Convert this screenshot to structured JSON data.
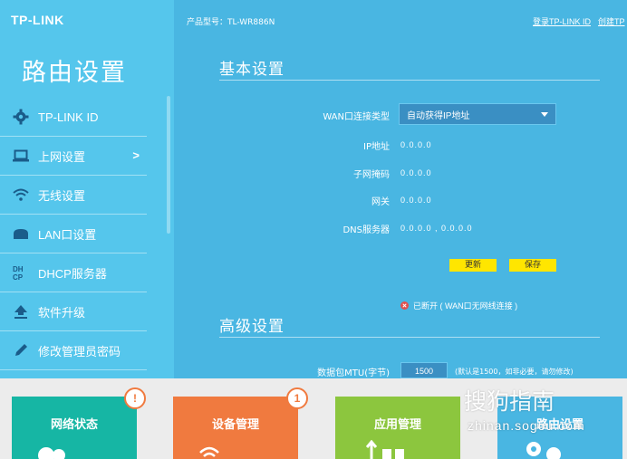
{
  "sidebar": {
    "logo": "TP-LINK",
    "title": "路由设置",
    "items": [
      {
        "label": "TP-LINK ID",
        "icon": "gear-icon",
        "arrow": ""
      },
      {
        "label": "上网设置",
        "icon": "laptop-icon",
        "arrow": ">"
      },
      {
        "label": "无线设置",
        "icon": "wifi-icon",
        "arrow": ""
      },
      {
        "label": "LAN口设置",
        "icon": "lan-icon",
        "arrow": ""
      },
      {
        "label": "DHCP服务器",
        "icon": "dhcp-icon",
        "arrow": ""
      },
      {
        "label": "软件升级",
        "icon": "upload-icon",
        "arrow": ""
      },
      {
        "label": "修改管理员密码",
        "icon": "pencil-icon",
        "arrow": ""
      }
    ]
  },
  "header": {
    "model": "产品型号：TL-WR886N",
    "login": "登录TP-LINK ID",
    "create": "创建TP"
  },
  "basic": {
    "title": "基本设置",
    "wan_label": "WAN口连接类型",
    "wan_value": "自动获得IP地址",
    "ip_label": "IP地址",
    "ip_value": "0.0.0.0",
    "mask_label": "子网掩码",
    "mask_value": "0.0.0.0",
    "gateway_label": "网关",
    "gateway_value": "0.0.0.0",
    "dns_label": "DNS服务器",
    "dns_value": "0.0.0.0 , 0.0.0.0",
    "refresh_label": "更新",
    "save_label": "保存",
    "status": "已断开 ( WAN口无网线连接 )"
  },
  "advanced": {
    "title": "高级设置",
    "mtu_label": "数据包MTU(字节)",
    "mtu_value": "1500",
    "mtu_hint": "(默认是1500，如非必要，请勿修改)"
  },
  "tiles": [
    {
      "label": "网络状态",
      "badge": "!",
      "color": "#16b6a4"
    },
    {
      "label": "设备管理",
      "badge": "1",
      "color": "#f07a3f"
    },
    {
      "label": "应用管理",
      "badge": "",
      "color": "#8cc63e"
    },
    {
      "label": "路由设置",
      "badge": "",
      "color": "#49b6e2"
    }
  ],
  "watermark": {
    "text": "搜狗指南",
    "url": "zhinan.sogou.com"
  }
}
